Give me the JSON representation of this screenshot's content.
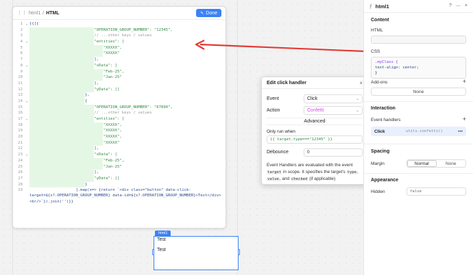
{
  "editor": {
    "breadcrumb_parent": "html1",
    "breadcrumb_sep": "/",
    "breadcrumb_current": "HTML",
    "done_label": "Done",
    "lines": [
      {
        "n": "1",
        "fold": "⌄",
        "text": "{{[{"
      },
      {
        "n": "2",
        "fold": "",
        "text": "                            \"OPERATION_GROUP_NUMBER\": \"12345\","
      },
      {
        "n": "3",
        "fold": "",
        "text": "                            // ...other keys / values"
      },
      {
        "n": "4",
        "fold": "⌄",
        "text": "                            \"entities\": ["
      },
      {
        "n": "5",
        "fold": "",
        "text": "                                \"XXXXX\","
      },
      {
        "n": "6",
        "fold": "",
        "text": "                                \"XXXXX\""
      },
      {
        "n": "7",
        "fold": "",
        "text": "                            ],"
      },
      {
        "n": "8",
        "fold": "⌄",
        "text": "                            \"xData\": ["
      },
      {
        "n": "9",
        "fold": "",
        "text": "                                \"Feb-25\","
      },
      {
        "n": "10",
        "fold": "",
        "text": "                                \"Jan-25\""
      },
      {
        "n": "11",
        "fold": "",
        "text": "                            ],"
      },
      {
        "n": "12",
        "fold": "",
        "text": "                            \"yData\": []"
      },
      {
        "n": "13",
        "fold": "",
        "text": "                        },"
      },
      {
        "n": "14",
        "fold": "⌄",
        "text": "                        {"
      },
      {
        "n": "15",
        "fold": "",
        "text": "                            \"OPERATION_GROUP_NUMBER\": \"67890\","
      },
      {
        "n": "16",
        "fold": "",
        "text": "                            // ...other keys / values"
      },
      {
        "n": "17",
        "fold": "⌄",
        "text": "                            \"entities\": ["
      },
      {
        "n": "18",
        "fold": "",
        "text": "                                \"XXXXX\","
      },
      {
        "n": "19",
        "fold": "",
        "text": "                                \"XXXXX\","
      },
      {
        "n": "20",
        "fold": "",
        "text": "                                \"XXXXX\","
      },
      {
        "n": "21",
        "fold": "",
        "text": "                                \"XXXXX\""
      },
      {
        "n": "22",
        "fold": "",
        "text": "                            ],"
      },
      {
        "n": "23",
        "fold": "⌄",
        "text": "                            \"xData\": ["
      },
      {
        "n": "24",
        "fold": "",
        "text": "                                \"Feb-25\","
      },
      {
        "n": "25",
        "fold": "",
        "text": "                                \"Jan-25\""
      },
      {
        "n": "26",
        "fold": "",
        "text": "                            ],"
      },
      {
        "n": "27",
        "fold": "",
        "text": "                            \"yData\": []"
      },
      {
        "n": "28",
        "fold": "",
        "text": "                        }"
      }
    ],
    "line29_n": "29",
    "line29_text": "                    ].map(x=> {return `<div class=\"button\" data-click-target=${x?.OPERATION_GROUP_NUMBER} data-id=${x?.OPERATION_GROUP_NUMBER}>Test</div><br/>`}).join('')}}"
  },
  "component": {
    "tag": "html1",
    "item1": "Test",
    "item2": "Test"
  },
  "popover": {
    "title": "Edit click handler",
    "close": "×",
    "event_label": "Event",
    "event_value": "Click",
    "action_label": "Action",
    "action_value": "Confetti",
    "advanced_label": "Advanced",
    "only_run_when_label": "Only run when",
    "only_run_when_value": "{{ target.type===\"12345\" }}",
    "debounce_label": "Debounce",
    "debounce_value": "0",
    "note_1": "Event Handlers are evaluated with the event",
    "note_target": "target",
    "note_2": " in scope. It specifies the target's ",
    "note_type": "type",
    "note_3": ", ",
    "note_value": "value",
    "note_4": ", and ",
    "note_checked": "checked",
    "note_5": " (if applicable)"
  },
  "inspector": {
    "name": "html1",
    "content_title": "Content",
    "html_label": "HTML",
    "css_label": "CSS",
    "css_lines": [
      ".myClass {",
      "  text-align: center;",
      "}"
    ],
    "addons_title": "Add-ons",
    "addons_none": "None",
    "interaction_title": "Interaction",
    "event_handlers_label": "Event handlers",
    "handler_event": "Click",
    "handler_action": "utils.confetti()",
    "handler_more": "•••",
    "spacing_title": "Spacing",
    "margin_label": "Margin",
    "margin_normal": "Normal",
    "margin_none": "None",
    "appearance_title": "Appearance",
    "hidden_label": "Hidden",
    "hidden_value": "false"
  },
  "colors": {
    "accent": "#3b82f6",
    "arrow": "#e53935",
    "code_string": "#2c8a3f",
    "code_highlight": "#e4f7e4"
  }
}
